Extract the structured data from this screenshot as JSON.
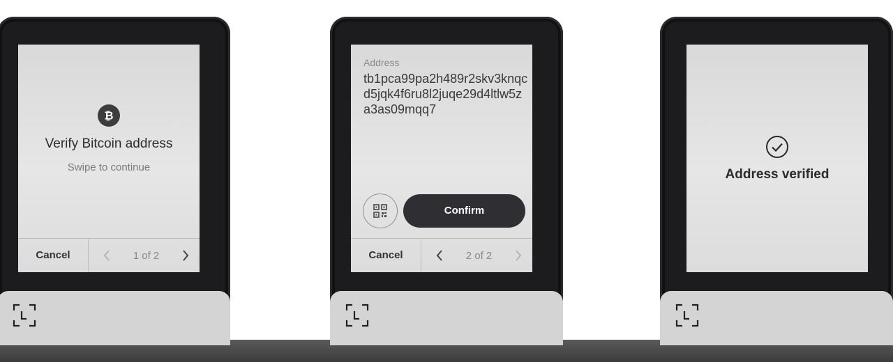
{
  "screen1": {
    "icon": "bitcoin-icon",
    "title": "Verify Bitcoin address",
    "subtitle": "Swipe to continue",
    "cancel_label": "Cancel",
    "page_indicator": "1 of 2"
  },
  "screen2": {
    "label": "Address",
    "address": "tb1pca99pa2h489r2skv3knqcd5jqk4f6ru8l2juqe29d4ltlw5za3as09mqq7",
    "qr_icon": "qr-code-icon",
    "confirm_label": "Confirm",
    "cancel_label": "Cancel",
    "page_indicator": "2 of 2"
  },
  "screen3": {
    "icon": "checkmark-circle-icon",
    "title": "Address verified"
  },
  "base_icon": "ledger-logo-icon",
  "colors": {
    "device_frame": "#1c1c1e",
    "screen_bg": "#e0e0e0",
    "button_dark": "#2f2f33",
    "base": "#d4d4d4"
  }
}
